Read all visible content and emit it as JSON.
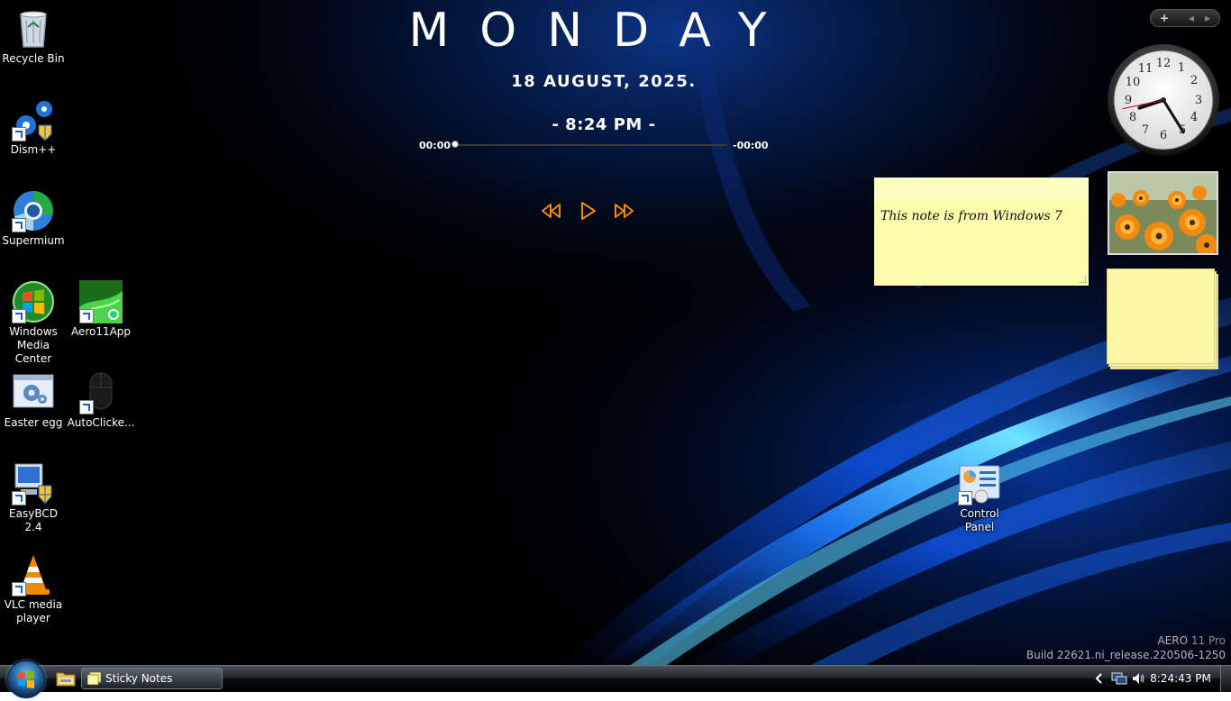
{
  "theme": {
    "accent": "#2a7fff",
    "media_orange": "#f08a00",
    "note_yellow": "#fcfcac",
    "taskbar_dark": "#0b0d10"
  },
  "desktop_icons": [
    {
      "label": "Recycle Bin",
      "icon": "recycle-bin-icon"
    },
    {
      "label": "Dism++",
      "icon": "dism-gears-icon"
    },
    {
      "label": "Supermium",
      "icon": "supermium-browser-icon"
    },
    {
      "label": "Windows Media Center",
      "icon": "windows-media-center-icon"
    },
    {
      "label": "Aero11App",
      "icon": "aero11app-icon"
    },
    {
      "label": "Easter egg",
      "icon": "easter-egg-icon"
    },
    {
      "label": "AutoClicke...",
      "icon": "mouse-icon"
    },
    {
      "label": "EasyBCD 2.4",
      "icon": "easybcd-icon"
    },
    {
      "label": "VLC media player",
      "icon": "vlc-cone-icon"
    },
    {
      "label": "Control Panel",
      "icon": "control-panel-icon"
    }
  ],
  "date_widget": {
    "day": "MONDAY",
    "date": "18  AUGUST,  2025.",
    "time": "- 8:24 PM -"
  },
  "media_player": {
    "elapsed": "00:00",
    "remaining": "-00:00",
    "progress": 0,
    "buttons": [
      "previous-icon",
      "play-icon",
      "next-icon"
    ]
  },
  "gadgets": {
    "toolbar_add": "+",
    "toolbar_prev": "◂",
    "toolbar_next": "▸",
    "clock": {
      "hour": 8,
      "minute": 24,
      "second": 43
    }
  },
  "sticky_note": {
    "text": "This note is from Windows 7"
  },
  "build_info": {
    "edition_name": "AERO",
    "edition_suffix": "11 Pro",
    "build": "Build 22621.ni_release.220506-1250"
  },
  "taskbar": {
    "task_label": "Sticky Notes",
    "tray_clock": "8:24:43 PM"
  }
}
